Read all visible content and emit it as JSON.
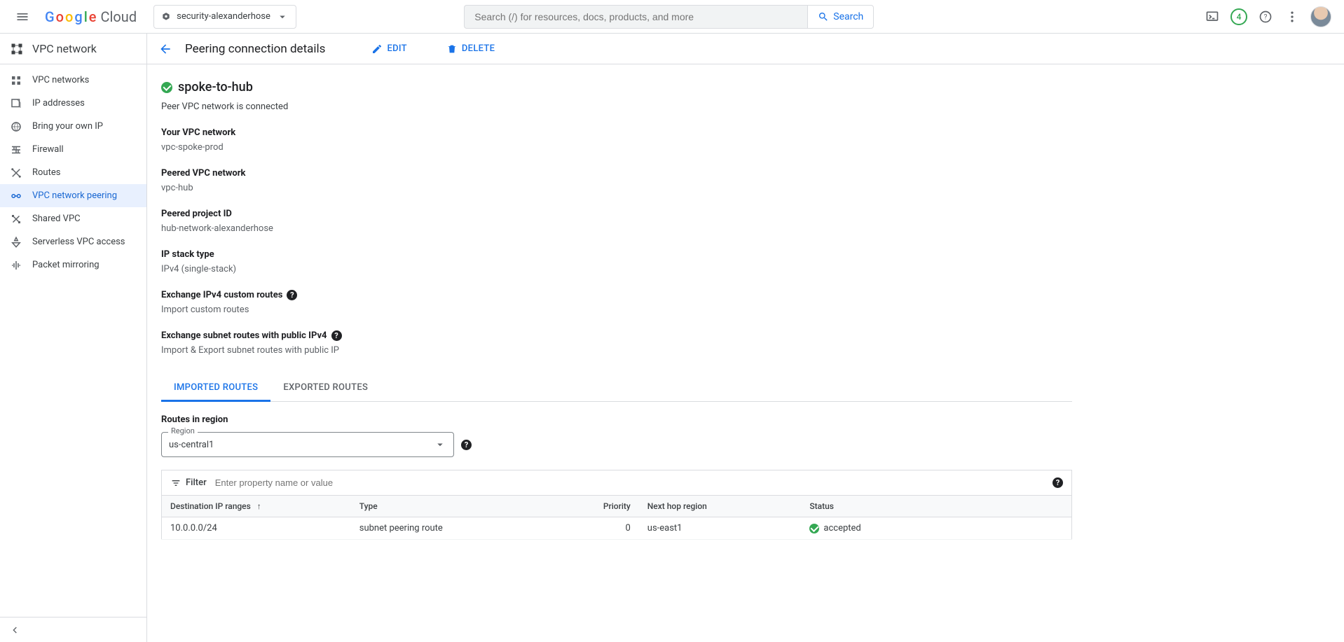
{
  "header": {
    "product": "Cloud",
    "project": "security-alexanderhose",
    "search_placeholder": "Search (/) for resources, docs, products, and more",
    "search_button": "Search",
    "notif_count": "4"
  },
  "sidebar": {
    "title": "VPC network",
    "items": [
      "VPC networks",
      "IP addresses",
      "Bring your own IP",
      "Firewall",
      "Routes",
      "VPC network peering",
      "Shared VPC",
      "Serverless VPC access",
      "Packet mirroring"
    ]
  },
  "page": {
    "title": "Peering connection details",
    "edit": "EDIT",
    "delete": "DELETE",
    "name": "spoke-to-hub",
    "status_line": "Peer VPC network is connected",
    "fields": {
      "your_vpc_label": "Your VPC network",
      "your_vpc_value": "vpc-spoke-prod",
      "peered_vpc_label": "Peered VPC network",
      "peered_vpc_value": "vpc-hub",
      "peered_proj_label": "Peered project ID",
      "peered_proj_value": "hub-network-alexanderhose",
      "ip_stack_label": "IP stack type",
      "ip_stack_value": "IPv4 (single-stack)",
      "exch_custom_label": "Exchange IPv4 custom routes",
      "exch_custom_value": "Import custom routes",
      "exch_public_label": "Exchange subnet routes with public IPv4",
      "exch_public_value": "Import & Export subnet routes with public IP"
    },
    "tabs": {
      "imported": "IMPORTED ROUTES",
      "exported": "EXPORTED ROUTES"
    },
    "routes_in_region": "Routes in region",
    "region_label": "Region",
    "region_value": "us-central1",
    "filter_label": "Filter",
    "filter_placeholder": "Enter property name or value",
    "table": {
      "headers": {
        "dest": "Destination IP ranges",
        "type": "Type",
        "priority": "Priority",
        "next_hop": "Next hop region",
        "status": "Status"
      },
      "rows": [
        {
          "dest": "10.0.0.0/24",
          "type": "subnet peering route",
          "priority": "0",
          "next_hop": "us-east1",
          "status": "accepted"
        }
      ]
    }
  }
}
